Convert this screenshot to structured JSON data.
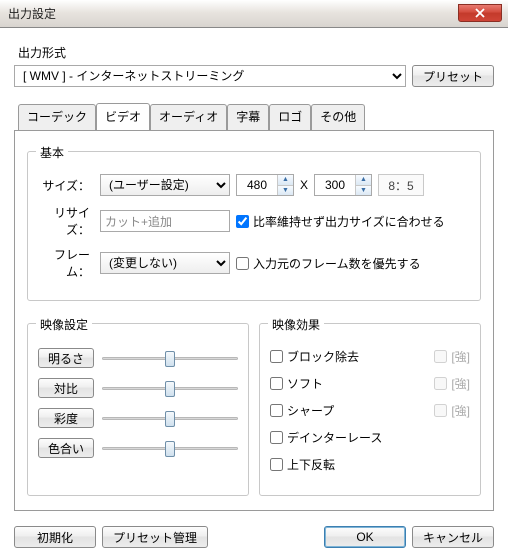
{
  "window": {
    "title": "出力設定",
    "close_icon": "close-icon"
  },
  "format": {
    "label": "出力形式",
    "selected": "[ WMV ] - インターネットストリーミング",
    "preset_btn": "プリセット"
  },
  "tabs": [
    "コーデック",
    "ビデオ",
    "オーディオ",
    "字幕",
    "ロゴ",
    "その他"
  ],
  "active_tab": 1,
  "basic": {
    "title": "基本",
    "size_label": "サイズ：",
    "size_select": "(ユーザー設定)",
    "width": "480",
    "height": "300",
    "x": "X",
    "ratio": "8：5",
    "resize_label": "リサイズ：",
    "resize_value": "カット+追加",
    "keep_aspect_checked": true,
    "keep_aspect_label": "比率維持せず出力サイズに合わせる",
    "frame_label": "フレーム：",
    "frame_select": "(変更しない)",
    "prioritize_src_checked": false,
    "prioritize_src_label": "入力元のフレーム数を優先する"
  },
  "video_settings": {
    "title": "映像設定",
    "items": [
      {
        "label": "明るさ",
        "value": 50
      },
      {
        "label": "対比",
        "value": 50
      },
      {
        "label": "彩度",
        "value": 50
      },
      {
        "label": "色合い",
        "value": 50
      }
    ]
  },
  "video_effects": {
    "title": "映像効果",
    "strong_label": "[強]",
    "items": [
      {
        "label": "ブロック除去",
        "strong": true
      },
      {
        "label": "ソフト",
        "strong": true
      },
      {
        "label": "シャープ",
        "strong": true
      },
      {
        "label": "デインターレース",
        "strong": false
      },
      {
        "label": "上下反転",
        "strong": false
      }
    ]
  },
  "footer": {
    "reset": "初期化",
    "presets": "プリセット管理",
    "ok": "OK",
    "cancel": "キャンセル"
  }
}
